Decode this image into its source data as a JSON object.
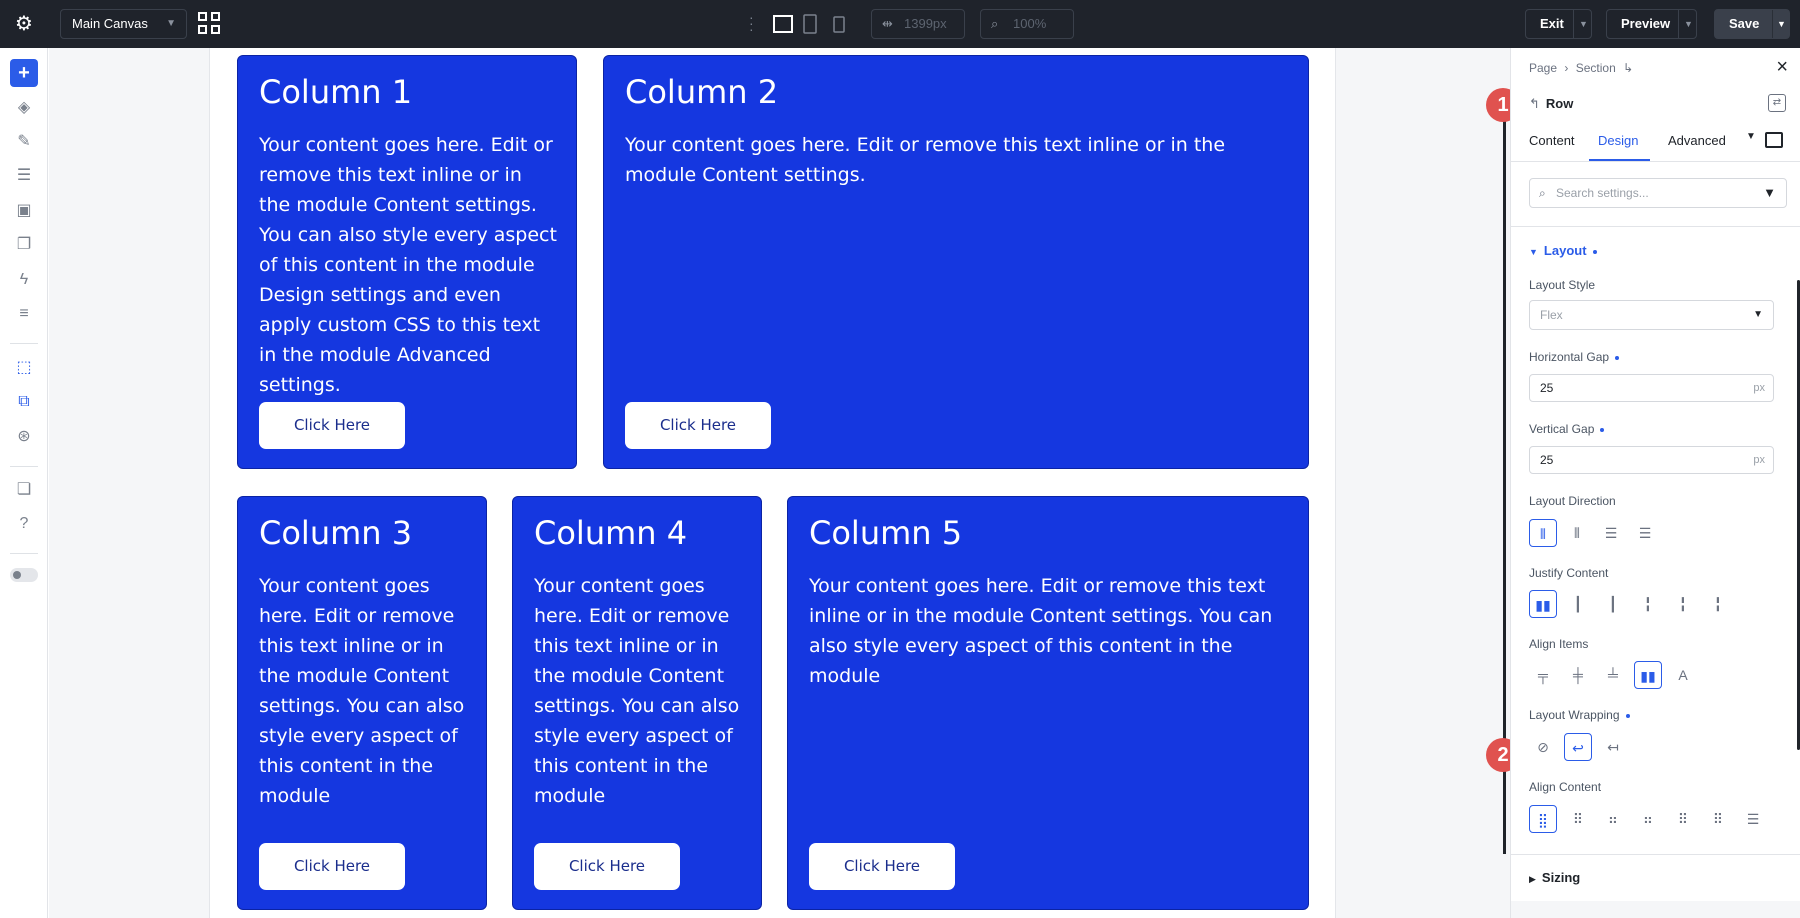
{
  "topbar": {
    "canvas_select": "Main Canvas",
    "width_value": "1399px",
    "zoom_value": "100%",
    "exit_label": "Exit",
    "preview_label": "Preview",
    "save_label": "Save"
  },
  "canvas": {
    "columns": [
      {
        "title": "Column 1",
        "body": "Your content goes here. Edit or remove this text inline or in the module Content settings. You can also style every aspect of this content in the module Design settings and even apply custom CSS to this text in the module Advanced settings.",
        "button": "Click Here"
      },
      {
        "title": "Column 2",
        "body": "Your content goes here. Edit or remove this text inline or in the module Content settings.",
        "button": "Click Here"
      },
      {
        "title": "Column 3",
        "body": "Your content goes here. Edit or remove this text inline or in the module Content settings. You can also style every aspect of this content in the module",
        "button": "Click Here"
      },
      {
        "title": "Column 4",
        "body": "Your content goes here. Edit or remove this text inline or in the module Content settings. You can also style every aspect of this content in the module",
        "button": "Click Here"
      },
      {
        "title": "Column 5",
        "body": "Your content goes here. Edit or remove this text inline or in the module Content settings. You can also style every aspect of this content in the module",
        "button": "Click Here"
      }
    ]
  },
  "panel": {
    "breadcrumb": {
      "page": "Page",
      "section": "Section"
    },
    "element": "Row",
    "tabs": [
      "Content",
      "Design",
      "Advanced"
    ],
    "search_placeholder": "Search settings...",
    "layout_section": "Layout",
    "layout_style_label": "Layout Style",
    "layout_style_value": "Flex",
    "hgap_label": "Horizontal Gap",
    "hgap_value": "25",
    "vgap_label": "Vertical Gap",
    "vgap_value": "25",
    "unit": "px",
    "direction_label": "Layout Direction",
    "justify_label": "Justify Content",
    "align_items_label": "Align Items",
    "wrapping_label": "Layout Wrapping",
    "align_content_label": "Align Content",
    "sizing_section": "Sizing"
  },
  "markers": [
    "1",
    "2"
  ],
  "colors": {
    "column_bg": "#1537e0",
    "accent": "#2b5ce8",
    "marker": "#e0524f",
    "topbar": "#1f232b"
  }
}
